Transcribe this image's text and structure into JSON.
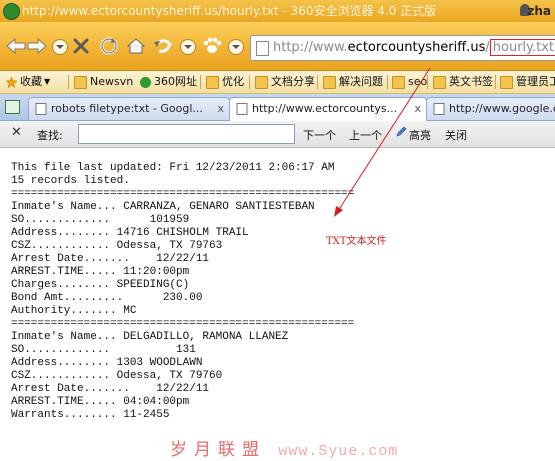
{
  "window": {
    "title": "http://www.ectorcountysheriff.us/hourly.txt - 360安全浏览器 4.0 正式版",
    "user": "zha"
  },
  "address_bar": {
    "prefix": "http://www.",
    "domain": "ectorcountysheriff.us",
    "separator": "/",
    "highlighted_path": "hourly.txt"
  },
  "favorites": [
    {
      "label": "收藏",
      "icon": "star-icon"
    },
    {
      "label": "Newsvn",
      "icon": "folder-icon"
    },
    {
      "label": "360网址",
      "icon": "360-icon"
    },
    {
      "label": "优化",
      "icon": "folder-icon"
    },
    {
      "label": "文档分享",
      "icon": "folder-icon"
    },
    {
      "label": "解决问题",
      "icon": "folder-icon"
    },
    {
      "label": "seo",
      "icon": "folder-icon"
    },
    {
      "label": "英文书签",
      "icon": "folder-icon"
    },
    {
      "label": "管理员工",
      "icon": "folder-icon"
    }
  ],
  "tabs": [
    {
      "label": "robots filetype:txt - Googl...",
      "close": "x",
      "active": false
    },
    {
      "label": "http://www.ectorcountys...",
      "close": "x",
      "active": true
    },
    {
      "label": "http://www.google.co",
      "close": "",
      "active": false
    }
  ],
  "find_bar": {
    "close": "✕",
    "label": "查找:",
    "value": "",
    "next_label": "下一个",
    "prev_label": "上一个",
    "highlight_label": "高亮",
    "close_label": "关闭"
  },
  "document": {
    "lines": [
      "This file last updated: Fri 12/23/2011 2:06:17 AM",
      "15 records listed.",
      "====================================================",
      "Inmate's Name... CARRANZA, GENARO SANTIESTEBAN",
      "SO.............      101959",
      "Address........ 14716 CHISHOLM TRAIL",
      "CSZ............ Odessa, TX 79763",
      "Arrest Date.......    12/22/11",
      "ARREST.TIME..... 11:20:00pm",
      "Charges........ SPEEDING(C)",
      "Bond Amt.........      230.00",
      "Authority....... MC",
      "====================================================",
      "Inmate's Name... DELGADILLO, RAMONA LLANEZ",
      "SO.............          131",
      "Address........ 1303 WOODLAWN",
      "CSZ............ Odessa, TX 79760",
      "Arrest Date.......    12/22/11",
      "ARREST.TIME..... 04:04:00pm",
      "Warrants........ 11-2455"
    ]
  },
  "annotation": {
    "text": "TXT文本文件",
    "color": "#d12020"
  },
  "watermark": {
    "text": "岁月联盟",
    "url": "www.Syue.com"
  }
}
